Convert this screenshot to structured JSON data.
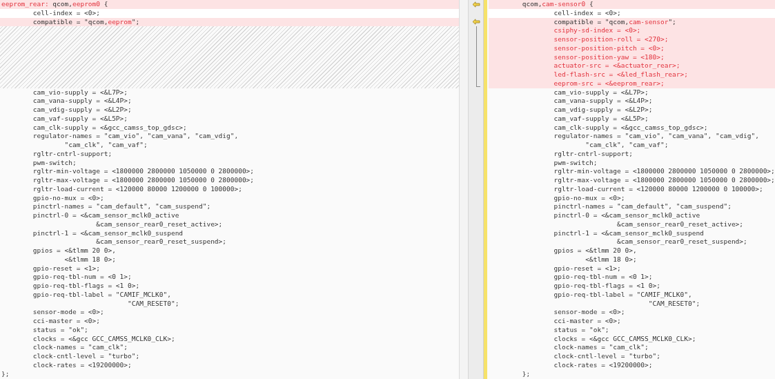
{
  "left": {
    "lines": [
      {
        "kind": "code",
        "changed": true,
        "segments": [
          {
            "text": "eeprom_rear:",
            "changed": true
          },
          {
            "text": " qcom,",
            "changed": false
          },
          {
            "text": "eeprom0",
            "changed": true
          },
          {
            "text": " {",
            "changed": false
          }
        ]
      },
      {
        "kind": "code",
        "changed": false,
        "segments": [
          {
            "text": "        cell-index = <0>;",
            "changed": false
          }
        ]
      },
      {
        "kind": "code",
        "changed": true,
        "segments": [
          {
            "text": "        compatible = \"qcom,",
            "changed": false
          },
          {
            "text": "eeprom",
            "changed": true
          },
          {
            "text": "\";",
            "changed": false
          }
        ]
      },
      {
        "kind": "filler"
      },
      {
        "kind": "filler"
      },
      {
        "kind": "filler"
      },
      {
        "kind": "filler"
      },
      {
        "kind": "filler"
      },
      {
        "kind": "filler"
      },
      {
        "kind": "filler"
      },
      {
        "kind": "code",
        "changed": false,
        "segments": [
          {
            "text": "        cam_vio-supply = <&L7P>;",
            "changed": false
          }
        ]
      },
      {
        "kind": "code",
        "changed": false,
        "segments": [
          {
            "text": "        cam_vana-supply = <&L4P>;",
            "changed": false
          }
        ]
      },
      {
        "kind": "code",
        "changed": false,
        "segments": [
          {
            "text": "        cam_vdig-supply = <&L2P>;",
            "changed": false
          }
        ]
      },
      {
        "kind": "code",
        "changed": false,
        "segments": [
          {
            "text": "        cam_vaf-supply = <&L5P>;",
            "changed": false
          }
        ]
      },
      {
        "kind": "code",
        "changed": false,
        "segments": [
          {
            "text": "        cam_clk-supply = <&gcc_camss_top_gdsc>;",
            "changed": false
          }
        ]
      },
      {
        "kind": "code",
        "changed": false,
        "segments": [
          {
            "text": "        regulator-names = \"cam_vio\", \"cam_vana\", \"cam_vdig\",",
            "changed": false
          }
        ]
      },
      {
        "kind": "code",
        "changed": false,
        "segments": [
          {
            "text": "                \"cam_clk\", \"cam_vaf\";",
            "changed": false
          }
        ]
      },
      {
        "kind": "code",
        "changed": false,
        "segments": [
          {
            "text": "        rgltr-cntrl-support;",
            "changed": false
          }
        ]
      },
      {
        "kind": "code",
        "changed": false,
        "segments": [
          {
            "text": "        pwm-switch;",
            "changed": false
          }
        ]
      },
      {
        "kind": "code",
        "changed": false,
        "segments": [
          {
            "text": "        rgltr-min-voltage = <1800000 2800000 1050000 0 2800000>;",
            "changed": false
          }
        ]
      },
      {
        "kind": "code",
        "changed": false,
        "segments": [
          {
            "text": "        rgltr-max-voltage = <1800000 2800000 1050000 0 2800000>;",
            "changed": false
          }
        ]
      },
      {
        "kind": "code",
        "changed": false,
        "segments": [
          {
            "text": "        rgltr-load-current = <120000 80000 1200000 0 100000>;",
            "changed": false
          }
        ]
      },
      {
        "kind": "code",
        "changed": false,
        "segments": [
          {
            "text": "        gpio-no-mux = <0>;",
            "changed": false
          }
        ]
      },
      {
        "kind": "code",
        "changed": false,
        "segments": [
          {
            "text": "        pinctrl-names = \"cam_default\", \"cam_suspend\";",
            "changed": false
          }
        ]
      },
      {
        "kind": "code",
        "changed": false,
        "segments": [
          {
            "text": "        pinctrl-0 = <&cam_sensor_mclk0_active",
            "changed": false
          }
        ]
      },
      {
        "kind": "code",
        "changed": false,
        "segments": [
          {
            "text": "                        &cam_sensor_rear0_reset_active>;",
            "changed": false
          }
        ]
      },
      {
        "kind": "code",
        "changed": false,
        "segments": [
          {
            "text": "        pinctrl-1 = <&cam_sensor_mclk0_suspend",
            "changed": false
          }
        ]
      },
      {
        "kind": "code",
        "changed": false,
        "segments": [
          {
            "text": "                        &cam_sensor_rear0_reset_suspend>;",
            "changed": false
          }
        ]
      },
      {
        "kind": "code",
        "changed": false,
        "segments": [
          {
            "text": "        gpios = <&tlmm 20 0>,",
            "changed": false
          }
        ]
      },
      {
        "kind": "code",
        "changed": false,
        "segments": [
          {
            "text": "                <&tlmm 18 0>;",
            "changed": false
          }
        ]
      },
      {
        "kind": "code",
        "changed": false,
        "segments": [
          {
            "text": "        gpio-reset = <1>;",
            "changed": false
          }
        ]
      },
      {
        "kind": "code",
        "changed": false,
        "segments": [
          {
            "text": "        gpio-req-tbl-num = <0 1>;",
            "changed": false
          }
        ]
      },
      {
        "kind": "code",
        "changed": false,
        "segments": [
          {
            "text": "        gpio-req-tbl-flags = <1 0>;",
            "changed": false
          }
        ]
      },
      {
        "kind": "code",
        "changed": false,
        "segments": [
          {
            "text": "        gpio-req-tbl-label = \"CAMIF_MCLK0\",",
            "changed": false
          }
        ]
      },
      {
        "kind": "code",
        "changed": false,
        "segments": [
          {
            "text": "                                \"CAM_RESET0\";",
            "changed": false
          }
        ]
      },
      {
        "kind": "code",
        "changed": false,
        "segments": [
          {
            "text": "        sensor-mode = <0>;",
            "changed": false
          }
        ]
      },
      {
        "kind": "code",
        "changed": false,
        "segments": [
          {
            "text": "        cci-master = <0>;",
            "changed": false
          }
        ]
      },
      {
        "kind": "code",
        "changed": false,
        "segments": [
          {
            "text": "        status = \"ok\";",
            "changed": false
          }
        ]
      },
      {
        "kind": "code",
        "changed": false,
        "segments": [
          {
            "text": "        clocks = <&gcc GCC_CAMSS_MCLK0_CLK>;",
            "changed": false
          }
        ]
      },
      {
        "kind": "code",
        "changed": false,
        "segments": [
          {
            "text": "        clock-names = \"cam_clk\";",
            "changed": false
          }
        ]
      },
      {
        "kind": "code",
        "changed": false,
        "segments": [
          {
            "text": "        clock-cntl-level = \"turbo\";",
            "changed": false
          }
        ]
      },
      {
        "kind": "code",
        "changed": false,
        "segments": [
          {
            "text": "        clock-rates = <19200000>;",
            "changed": false
          }
        ]
      },
      {
        "kind": "code",
        "changed": false,
        "segments": [
          {
            "text": "};",
            "changed": false
          }
        ]
      }
    ]
  },
  "right": {
    "lines": [
      {
        "kind": "code",
        "changed": true,
        "merge_arrow": true,
        "segments": [
          {
            "text": "        qcom,",
            "changed": false
          },
          {
            "text": "cam-sensor0",
            "changed": true
          },
          {
            "text": " {",
            "changed": false
          }
        ]
      },
      {
        "kind": "code",
        "changed": false,
        "merge_arrow": false,
        "segments": [
          {
            "text": "                cell-index = <0>;",
            "changed": false
          }
        ]
      },
      {
        "kind": "code",
        "changed": true,
        "merge_arrow": true,
        "segments": [
          {
            "text": "                compatible = \"qcom,",
            "changed": false
          },
          {
            "text": "cam-sensor",
            "changed": true
          },
          {
            "text": "\";",
            "changed": false
          }
        ]
      },
      {
        "kind": "code",
        "changed": true,
        "merge_arrow": false,
        "segments": [
          {
            "text": "                csiphy-sd-index = <0>;",
            "changed": true
          }
        ]
      },
      {
        "kind": "code",
        "changed": true,
        "merge_arrow": false,
        "segments": [
          {
            "text": "                sensor-position-roll = <270>;",
            "changed": true
          }
        ]
      },
      {
        "kind": "code",
        "changed": true,
        "merge_arrow": false,
        "segments": [
          {
            "text": "                sensor-position-pitch = <0>;",
            "changed": true
          }
        ]
      },
      {
        "kind": "code",
        "changed": true,
        "merge_arrow": false,
        "segments": [
          {
            "text": "                sensor-position-yaw = <180>;",
            "changed": true
          }
        ]
      },
      {
        "kind": "code",
        "changed": true,
        "merge_arrow": false,
        "segments": [
          {
            "text": "                actuator-src = <&actuator_rear>;",
            "changed": true
          }
        ]
      },
      {
        "kind": "code",
        "changed": true,
        "merge_arrow": false,
        "segments": [
          {
            "text": "                led-flash-src = <&led_flash_rear>;",
            "changed": true
          }
        ]
      },
      {
        "kind": "code",
        "changed": true,
        "merge_arrow": false,
        "segments": [
          {
            "text": "                eeprom-src = <&eeprom_rear>;",
            "changed": true
          }
        ]
      },
      {
        "kind": "code",
        "changed": false,
        "merge_arrow": false,
        "segments": [
          {
            "text": "                cam_vio-supply = <&L7P>;",
            "changed": false
          }
        ]
      },
      {
        "kind": "code",
        "changed": false,
        "merge_arrow": false,
        "segments": [
          {
            "text": "                cam_vana-supply = <&L4P>;",
            "changed": false
          }
        ]
      },
      {
        "kind": "code",
        "changed": false,
        "merge_arrow": false,
        "segments": [
          {
            "text": "                cam_vdig-supply = <&L2P>;",
            "changed": false
          }
        ]
      },
      {
        "kind": "code",
        "changed": false,
        "merge_arrow": false,
        "segments": [
          {
            "text": "                cam_vaf-supply = <&L5P>;",
            "changed": false
          }
        ]
      },
      {
        "kind": "code",
        "changed": false,
        "merge_arrow": false,
        "segments": [
          {
            "text": "                cam_clk-supply = <&gcc_camss_top_gdsc>;",
            "changed": false
          }
        ]
      },
      {
        "kind": "code",
        "changed": false,
        "merge_arrow": false,
        "segments": [
          {
            "text": "                regulator-names = \"cam_vio\", \"cam_vana\", \"cam_vdig\",",
            "changed": false
          }
        ]
      },
      {
        "kind": "code",
        "changed": false,
        "merge_arrow": false,
        "segments": [
          {
            "text": "                        \"cam_clk\", \"cam_vaf\";",
            "changed": false
          }
        ]
      },
      {
        "kind": "code",
        "changed": false,
        "merge_arrow": false,
        "segments": [
          {
            "text": "                rgltr-cntrl-support;",
            "changed": false
          }
        ]
      },
      {
        "kind": "code",
        "changed": false,
        "merge_arrow": false,
        "segments": [
          {
            "text": "                pwm-switch;",
            "changed": false
          }
        ]
      },
      {
        "kind": "code",
        "changed": false,
        "merge_arrow": false,
        "segments": [
          {
            "text": "                rgltr-min-voltage = <1800000 2800000 1050000 0 2800000>;",
            "changed": false
          }
        ]
      },
      {
        "kind": "code",
        "changed": false,
        "merge_arrow": false,
        "segments": [
          {
            "text": "                rgltr-max-voltage = <1800000 2800000 1050000 0 2800000>;",
            "changed": false
          }
        ]
      },
      {
        "kind": "code",
        "changed": false,
        "merge_arrow": false,
        "segments": [
          {
            "text": "                rgltr-load-current = <120000 80000 1200000 0 100000>;",
            "changed": false
          }
        ]
      },
      {
        "kind": "code",
        "changed": false,
        "merge_arrow": false,
        "segments": [
          {
            "text": "                gpio-no-mux = <0>;",
            "changed": false
          }
        ]
      },
      {
        "kind": "code",
        "changed": false,
        "merge_arrow": false,
        "segments": [
          {
            "text": "                pinctrl-names = \"cam_default\", \"cam_suspend\";",
            "changed": false
          }
        ]
      },
      {
        "kind": "code",
        "changed": false,
        "merge_arrow": false,
        "segments": [
          {
            "text": "                pinctrl-0 = <&cam_sensor_mclk0_active",
            "changed": false
          }
        ]
      },
      {
        "kind": "code",
        "changed": false,
        "merge_arrow": false,
        "segments": [
          {
            "text": "                                &cam_sensor_rear0_reset_active>;",
            "changed": false
          }
        ]
      },
      {
        "kind": "code",
        "changed": false,
        "merge_arrow": false,
        "segments": [
          {
            "text": "                pinctrl-1 = <&cam_sensor_mclk0_suspend",
            "changed": false
          }
        ]
      },
      {
        "kind": "code",
        "changed": false,
        "merge_arrow": false,
        "segments": [
          {
            "text": "                                &cam_sensor_rear0_reset_suspend>;",
            "changed": false
          }
        ]
      },
      {
        "kind": "code",
        "changed": false,
        "merge_arrow": false,
        "segments": [
          {
            "text": "                gpios = <&tlmm 20 0>,",
            "changed": false
          }
        ]
      },
      {
        "kind": "code",
        "changed": false,
        "merge_arrow": false,
        "segments": [
          {
            "text": "                        <&tlmm 18 0>;",
            "changed": false
          }
        ]
      },
      {
        "kind": "code",
        "changed": false,
        "merge_arrow": false,
        "segments": [
          {
            "text": "                gpio-reset = <1>;",
            "changed": false
          }
        ]
      },
      {
        "kind": "code",
        "changed": false,
        "merge_arrow": false,
        "segments": [
          {
            "text": "                gpio-req-tbl-num = <0 1>;",
            "changed": false
          }
        ]
      },
      {
        "kind": "code",
        "changed": false,
        "merge_arrow": false,
        "segments": [
          {
            "text": "                gpio-req-tbl-flags = <1 0>;",
            "changed": false
          }
        ]
      },
      {
        "kind": "code",
        "changed": false,
        "merge_arrow": false,
        "segments": [
          {
            "text": "                gpio-req-tbl-label = \"CAMIF_MCLK0\",",
            "changed": false
          }
        ]
      },
      {
        "kind": "code",
        "changed": false,
        "merge_arrow": false,
        "segments": [
          {
            "text": "                                        \"CAM_RESET0\";",
            "changed": false
          }
        ]
      },
      {
        "kind": "code",
        "changed": false,
        "merge_arrow": false,
        "segments": [
          {
            "text": "                sensor-mode = <0>;",
            "changed": false
          }
        ]
      },
      {
        "kind": "code",
        "changed": false,
        "merge_arrow": false,
        "segments": [
          {
            "text": "                cci-master = <0>;",
            "changed": false
          }
        ]
      },
      {
        "kind": "code",
        "changed": false,
        "merge_arrow": false,
        "segments": [
          {
            "text": "                status = \"ok\";",
            "changed": false
          }
        ]
      },
      {
        "kind": "code",
        "changed": false,
        "merge_arrow": false,
        "segments": [
          {
            "text": "                clocks = <&gcc GCC_CAMSS_MCLK0_CLK>;",
            "changed": false
          }
        ]
      },
      {
        "kind": "code",
        "changed": false,
        "merge_arrow": false,
        "segments": [
          {
            "text": "                clock-names = \"cam_clk\";",
            "changed": false
          }
        ]
      },
      {
        "kind": "code",
        "changed": false,
        "merge_arrow": false,
        "segments": [
          {
            "text": "                clock-cntl-level = \"turbo\";",
            "changed": false
          }
        ]
      },
      {
        "kind": "code",
        "changed": false,
        "merge_arrow": false,
        "segments": [
          {
            "text": "                clock-rates = <19200000>;",
            "changed": false
          }
        ]
      },
      {
        "kind": "code",
        "changed": false,
        "merge_arrow": false,
        "segments": [
          {
            "text": "        };",
            "changed": false
          }
        ]
      }
    ]
  }
}
